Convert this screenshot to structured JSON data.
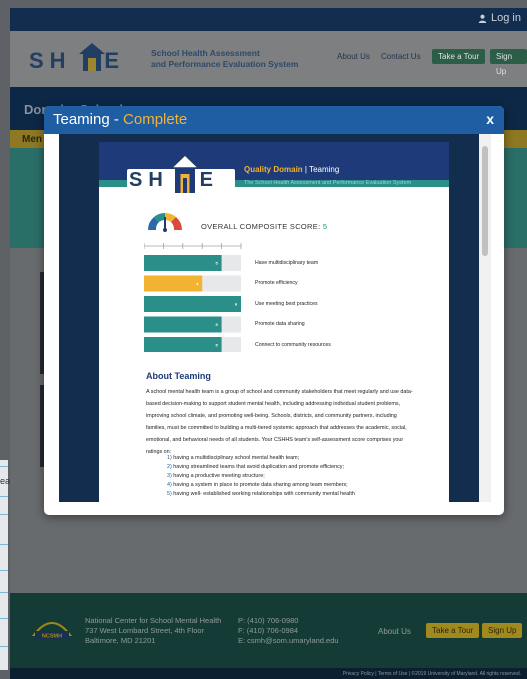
{
  "colors": {
    "navy": "#122d4e",
    "modal_header_blue": "#1f5ea3",
    "accent_gold": "#f2b333",
    "teal": "#2a8f89",
    "bar_teal": "#2a8f89",
    "bar_gold": "#f2b333"
  },
  "topbar": {
    "login_label": "Log in",
    "login_icon": "user-icon"
  },
  "header": {
    "logo_text": "SH PE",
    "subtitle_line1": "School Health Assessment",
    "subtitle_line2": "and Performance Evaluation System",
    "nav": {
      "about": "About Us",
      "contact": "Contact Us",
      "tour": "Take a Tour",
      "signup": "Sign Up"
    }
  },
  "background": {
    "navy_text": "Domain: School...",
    "gold_text": "Men"
  },
  "modal": {
    "title_main": "Teaming",
    "title_separator": " - ",
    "title_status": "Complete",
    "close_label": "x"
  },
  "document": {
    "logo_text": "SH PE",
    "quality_label": "Quality Domain",
    "separator": "|",
    "domain_name": "Teaming",
    "stripe_text": "The School Health Assessment and Performance Evaluation System",
    "overall_label": "OVERALL COMPOSITE SCORE:",
    "overall_score": "5",
    "about_title": "About Teaming",
    "about_text": "A school mental health team is a group of school and community stakeholders that meet regularly and use data-based decision-making to support student mental health, including addressing individual student problems, improving school climate, and promoting well-being. Schools, districts, and community partners, including families, must be committed to building a multi-tiered systemic approach that addresses the academic, social, emotional, and behavioral needs of all students. Your CSHHS team's self-assessment score comprises your ratings on:",
    "items": [
      {
        "num": "1)",
        "text": "having a multidisciplinary school mental health team;"
      },
      {
        "num": "2)",
        "text": "having streamlined teams that avoid duplication and promote efficiency;"
      },
      {
        "num": "3)",
        "text": "having a productive meeting structure;"
      },
      {
        "num": "4)",
        "text": "having a system in place to promote data sharing among team members;"
      },
      {
        "num": "5)",
        "text": "having well- established working relationships with community mental health"
      }
    ]
  },
  "chart_data": {
    "type": "bar",
    "orientation": "horizontal",
    "categories": [
      "Have multidisciplinary team",
      "Promote efficiency",
      "Use meeting best practices",
      "Promote data sharing",
      "Connect to community resources"
    ],
    "values": [
      5,
      4,
      6,
      5,
      5
    ],
    "value_labels": [
      "5",
      "4",
      "6",
      "5",
      "5"
    ],
    "bar_colors": [
      "#2a8f89",
      "#f2b333",
      "#2a8f89",
      "#2a8f89",
      "#2a8f89"
    ],
    "xlim": [
      1,
      6
    ],
    "ticks": [
      1,
      2,
      3,
      4,
      5,
      6
    ],
    "grid": false
  },
  "footer": {
    "org_line1": "National Center for School Mental Health",
    "org_line2": "737 West Lombard Street, 4th Floor",
    "org_line3": "Baltimore, MD 21201",
    "phone": "P: (410) 706-0980",
    "fax": "F: (410) 706-0984",
    "email": "E: csmh@som.umaryland.edu",
    "about": "About Us",
    "tour": "Take a Tour",
    "signup": "Sign Up",
    "logo_text": "NCSMH",
    "bottom_text": "Privacy Policy | Terms of Use | ©2019 University of Maryland. All rights reserved."
  },
  "cut_text": "ea"
}
